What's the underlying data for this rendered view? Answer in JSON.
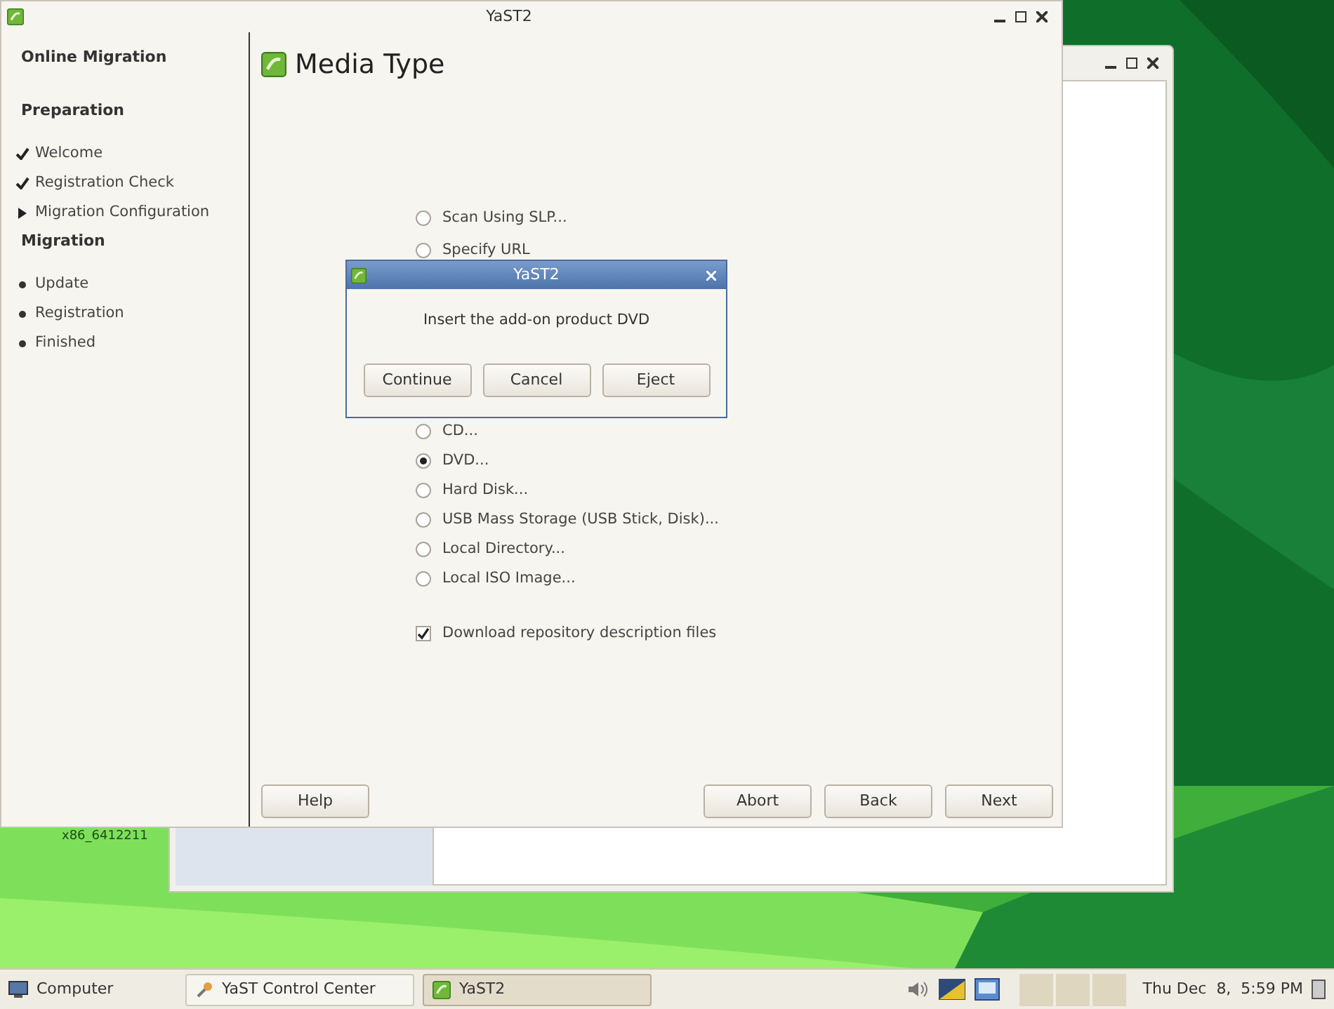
{
  "main_window": {
    "title": "YaST2",
    "sidebar": {
      "title": "Online Migration",
      "sections": [
        {
          "heading": "Preparation",
          "steps": [
            {
              "label": "Welcome",
              "kind": "done"
            },
            {
              "label": "Registration Check",
              "kind": "done"
            },
            {
              "label": "Migration Configuration",
              "kind": "current"
            }
          ]
        },
        {
          "heading": "Migration",
          "steps": [
            {
              "label": "Update",
              "kind": "pending"
            },
            {
              "label": "Registration",
              "kind": "pending"
            },
            {
              "label": "Finished",
              "kind": "pending"
            }
          ]
        }
      ]
    },
    "page_title": "Media Type",
    "media_options": [
      {
        "label": "Scan Using SLP...",
        "selected": false
      },
      {
        "label": "Specify URL",
        "selected": false
      },
      {
        "label": "CD...",
        "selected": false
      },
      {
        "label": "DVD...",
        "selected": true
      },
      {
        "label": "Hard Disk...",
        "selected": false
      },
      {
        "label": "USB Mass Storage (USB Stick, Disk)...",
        "selected": false
      },
      {
        "label": "Local Directory...",
        "selected": false
      },
      {
        "label": "Local ISO Image...",
        "selected": false
      }
    ],
    "download_checkbox": {
      "label": "Download repository description files",
      "checked": true
    },
    "help_button": "Help",
    "nav_buttons": [
      "Abort",
      "Back",
      "Next"
    ]
  },
  "dialog": {
    "title": "YaST2",
    "message": "Insert the add-on product DVD",
    "buttons": [
      "Continue",
      "Cancel",
      "Eject"
    ]
  },
  "desktop_label": "x86_6412211",
  "taskbar": {
    "start": "Computer",
    "tasks": [
      {
        "label": "YaST Control Center",
        "selected": false
      },
      {
        "label": "YaST2",
        "selected": true
      }
    ],
    "clock": "Thu Dec  8,  5:59 PM"
  }
}
